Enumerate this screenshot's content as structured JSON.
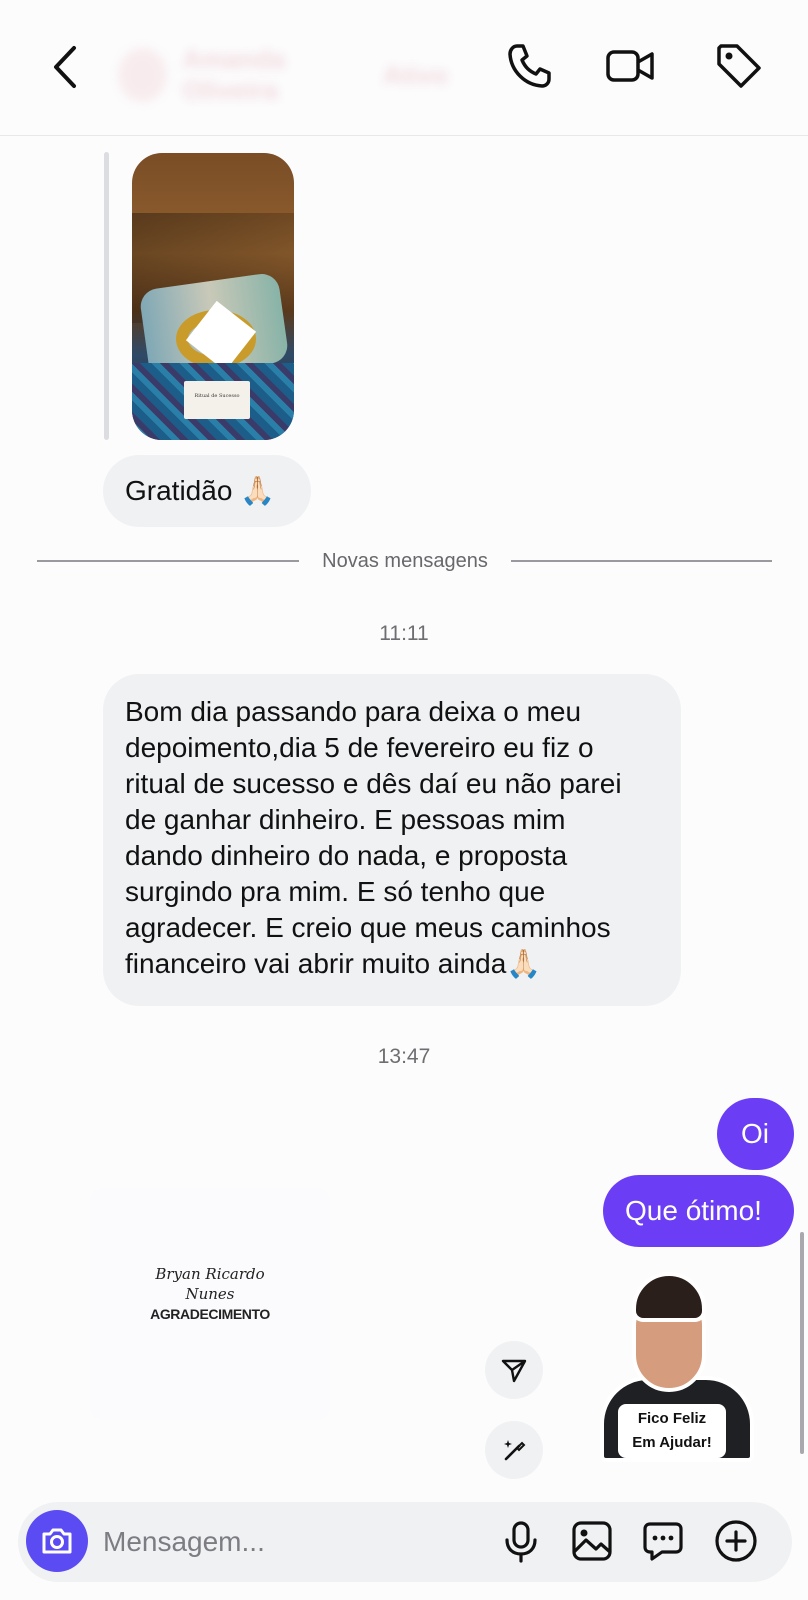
{
  "header": {
    "contact_name": "Amanda Oliveira",
    "contact_status": "Ativo"
  },
  "messages": {
    "photo_card_text": "Ritual de Sucesso",
    "gratidao": "Gratidão 🙏🏻",
    "divider_label": "Novas mensagens",
    "time_1": "11:11",
    "long_message": "Bom dia passando para deixa o meu\ndepoimento,dia 5 de fevereiro eu fiz o\nritual de sucesso e dês daí eu não parei\nde ganhar dinheiro. E pessoas mim\ndando dinheiro do nada, e proposta\nsurgindo pra mim. E só tenho que\nagradecer. E creio que meus caminhos\nfinanceiro vai abrir muito ainda🙏🏻",
    "time_2": "13:47",
    "out_oi": "Oi",
    "out_otimo": "Que ótimo!",
    "card_signature_1": "Bryan Ricardo",
    "card_signature_2": "Nunes",
    "card_heading": "AGRADECIMENTO",
    "sticker_line_1": "Fico Feliz",
    "sticker_line_2": "Em Ajudar!"
  },
  "composer": {
    "placeholder": "Mensagem..."
  },
  "colors": {
    "accent": "#6b3ef5",
    "camera": "#5b4bf2",
    "incoming_bubble": "#eff1f3"
  },
  "icons": [
    "back-icon",
    "phone-icon",
    "video-icon",
    "tag-icon",
    "share-icon",
    "sparkle-brush-icon",
    "camera-icon",
    "mic-icon",
    "gallery-icon",
    "chat-bubble-icon",
    "plus-icon"
  ]
}
